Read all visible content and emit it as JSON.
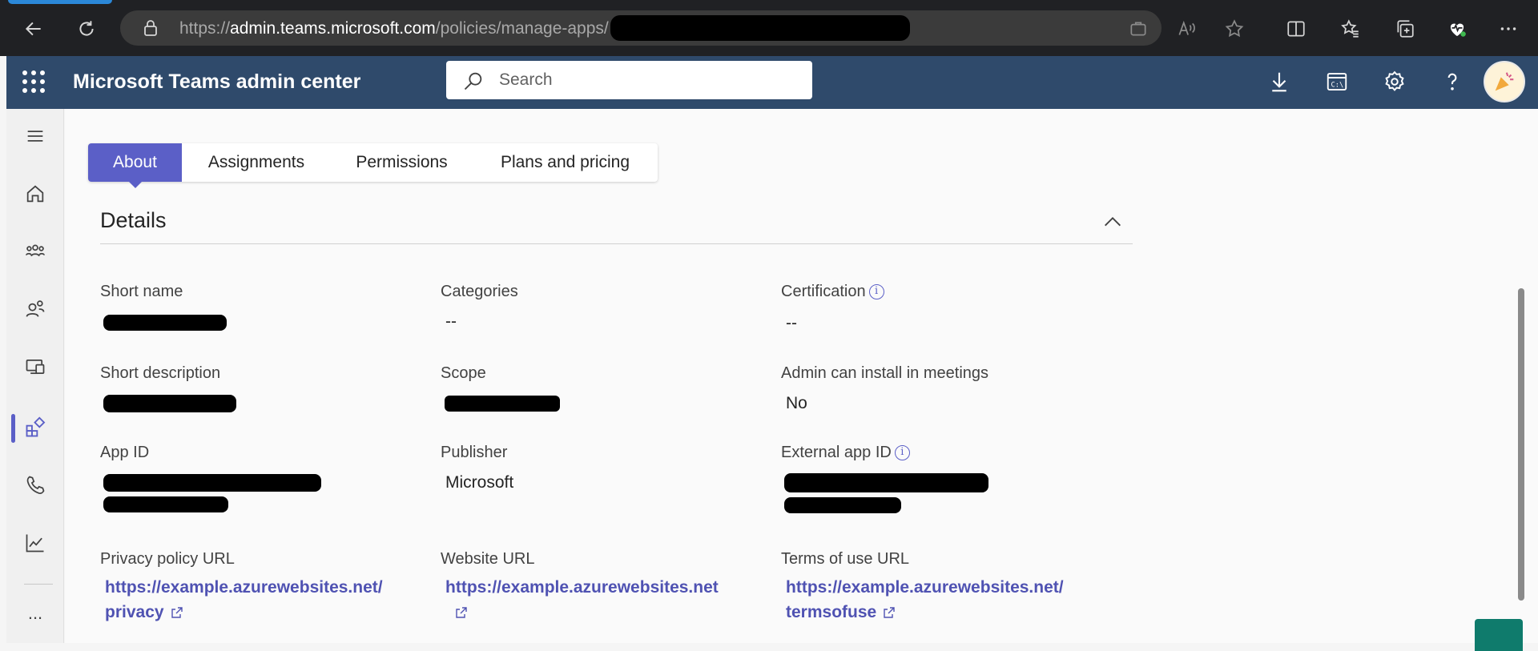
{
  "browser": {
    "url_prefix": "https://",
    "url_host": "admin.teams.microsoft.com",
    "url_path": "/policies/manage-apps/"
  },
  "header": {
    "title": "Microsoft Teams admin center",
    "search_placeholder": "Search"
  },
  "tabs": [
    {
      "label": "About",
      "active": true
    },
    {
      "label": "Assignments",
      "active": false
    },
    {
      "label": "Permissions",
      "active": false
    },
    {
      "label": "Plans and pricing",
      "active": false
    }
  ],
  "details": {
    "title": "Details",
    "short_name_label": "Short name",
    "categories_label": "Categories",
    "categories_value": "--",
    "certification_label": "Certification",
    "certification_value": "--",
    "short_description_label": "Short description",
    "scope_label": "Scope",
    "admin_install_label": "Admin can install in meetings",
    "admin_install_value": "No",
    "app_id_label": "App ID",
    "publisher_label": "Publisher",
    "publisher_value": "Microsoft",
    "external_app_id_label": "External app ID",
    "privacy_label": "Privacy policy URL",
    "privacy_url_line1": "https://example.azurewebsites.net/",
    "privacy_url_line2": "privacy",
    "website_label": "Website URL",
    "website_url": "https://example.azurewebsites.net",
    "terms_label": "Terms of use URL",
    "terms_url_line1": "https://example.azurewebsites.net/",
    "terms_url_line2": "termsofuse"
  },
  "rail": {
    "more_label": "..."
  },
  "colors": {
    "brand": "#5b5fc7",
    "header": "#2f4a6b",
    "link": "#4f52b2"
  }
}
